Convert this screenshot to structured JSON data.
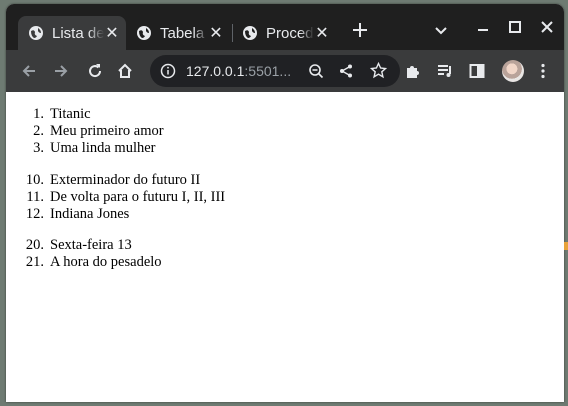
{
  "browser": {
    "tabs": [
      {
        "title": "Lista de filmes",
        "active": true,
        "icon": "globe-icon"
      },
      {
        "title": "Tabela",
        "active": false,
        "icon": "globe-icon"
      },
      {
        "title": "Procedimento",
        "active": false,
        "icon": "globe-icon"
      }
    ],
    "new_tab_icon": "plus-icon",
    "address": {
      "host": "127.0.0.1",
      "rest": ":5501..."
    },
    "colors": {
      "tabstrip": "#1f1f1f",
      "toolbar": "#3a3b3c",
      "omnibox": "#202124",
      "icon": "#e8eaed"
    }
  },
  "lists": [
    {
      "items": [
        {
          "num": "1.",
          "text": "Titanic"
        },
        {
          "num": "2.",
          "text": "Meu primeiro amor"
        },
        {
          "num": "3.",
          "text": "Uma linda mulher"
        }
      ]
    },
    {
      "items": [
        {
          "num": "10.",
          "text": "Exterminador do futuro II"
        },
        {
          "num": "11.",
          "text": "De volta para o futuru I, II, III"
        },
        {
          "num": "12.",
          "text": "Indiana Jones"
        }
      ]
    },
    {
      "items": [
        {
          "num": "20.",
          "text": "Sexta-feira 13"
        },
        {
          "num": "21.",
          "text": "A hora do pesadelo"
        }
      ]
    }
  ]
}
